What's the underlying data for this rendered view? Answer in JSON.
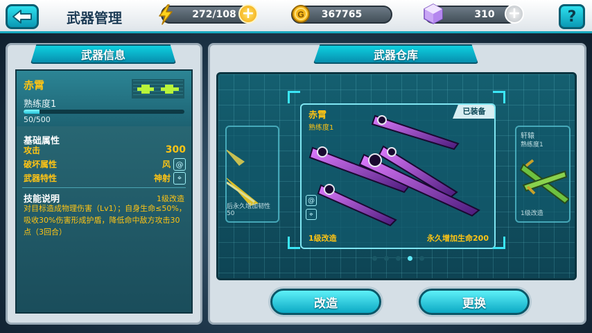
{
  "header": {
    "title": "武器管理",
    "energy": "272/108",
    "gold": "367765",
    "gems": "310"
  },
  "info_panel": {
    "tab": "武器信息",
    "weapon_name": "赤霄",
    "proficiency_label": "熟练度1",
    "proficiency_value": "50/500",
    "proficiency_fraction": 0.1,
    "base_attr_title": "基础属性",
    "stats": [
      {
        "label": "攻击",
        "value": "300"
      },
      {
        "label": "破坏属性",
        "value": "风"
      },
      {
        "label": "武器特性",
        "value": "神射"
      }
    ],
    "skill_title": "技能说明",
    "skill_level": "1级改造",
    "skill_desc": "对目标造成物理伤害（Lv1）；自身生命≤50%，吸收30%伤害形成护盾，降低命中敌方攻击30点（3回合）"
  },
  "warehouse": {
    "tab": "武器仓库",
    "cards": {
      "left": {
        "bonus": "后永久增加韧性50"
      },
      "main": {
        "name": "赤霄",
        "proficiency": "熟练度1",
        "equipped": "已装备",
        "upgrade": "1级改造",
        "bonus": "永久增加生命200"
      },
      "right": {
        "name": "轩辕",
        "proficiency": "熟练度1",
        "upgrade": "1级改造"
      }
    },
    "page_count": 5,
    "active_page": 4
  },
  "buttons": {
    "upgrade": "改造",
    "replace": "更换"
  },
  "colors": {
    "accent": "#0ed0e0",
    "highlight": "#ffc414"
  }
}
